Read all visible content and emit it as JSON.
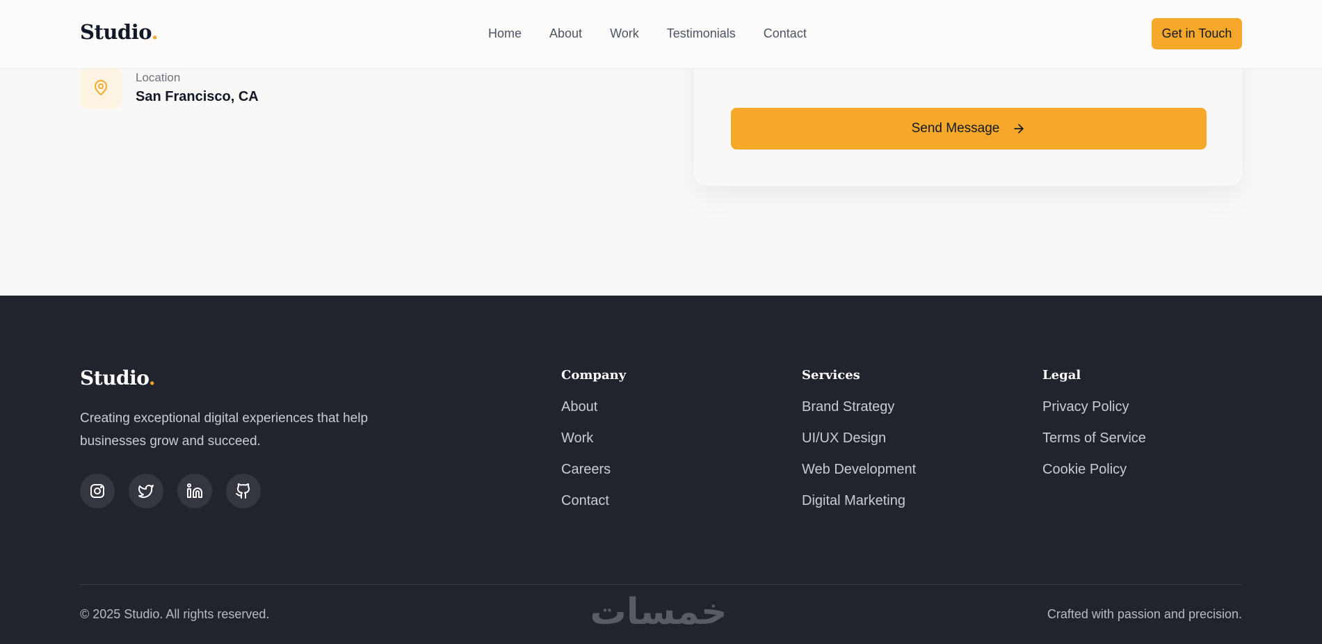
{
  "brand": {
    "name": "Studio",
    "dot": ".",
    "accent_color": "#f5a82a",
    "dark_color": "#22242d",
    "bg_color": "#faf8f6"
  },
  "nav": {
    "links": [
      "Home",
      "About",
      "Work",
      "Testimonials",
      "Contact"
    ],
    "cta_label": "Get in Touch"
  },
  "contact": {
    "location_icon": "map-pin-icon",
    "location_label": "Location",
    "location_value": "San Francisco, CA",
    "send_label": "Send Message",
    "send_icon": "arrow-right-icon"
  },
  "footer": {
    "tagline": "Creating exceptional digital experiences that help businesses grow and succeed.",
    "social_icons": [
      "instagram-icon",
      "twitter-icon",
      "linkedin-icon",
      "github-icon"
    ],
    "columns": [
      {
        "heading": "Company",
        "links": [
          "About",
          "Work",
          "Careers",
          "Contact"
        ]
      },
      {
        "heading": "Services",
        "links": [
          "Brand Strategy",
          "UI/UX Design",
          "Web Development",
          "Digital Marketing"
        ]
      },
      {
        "heading": "Legal",
        "links": [
          "Privacy Policy",
          "Terms of Service",
          "Cookie Policy"
        ]
      }
    ],
    "copyright": "© 2025 Studio. All rights reserved.",
    "crafted": "Crafted with passion and precision.",
    "watermark_text": "خمسات"
  }
}
